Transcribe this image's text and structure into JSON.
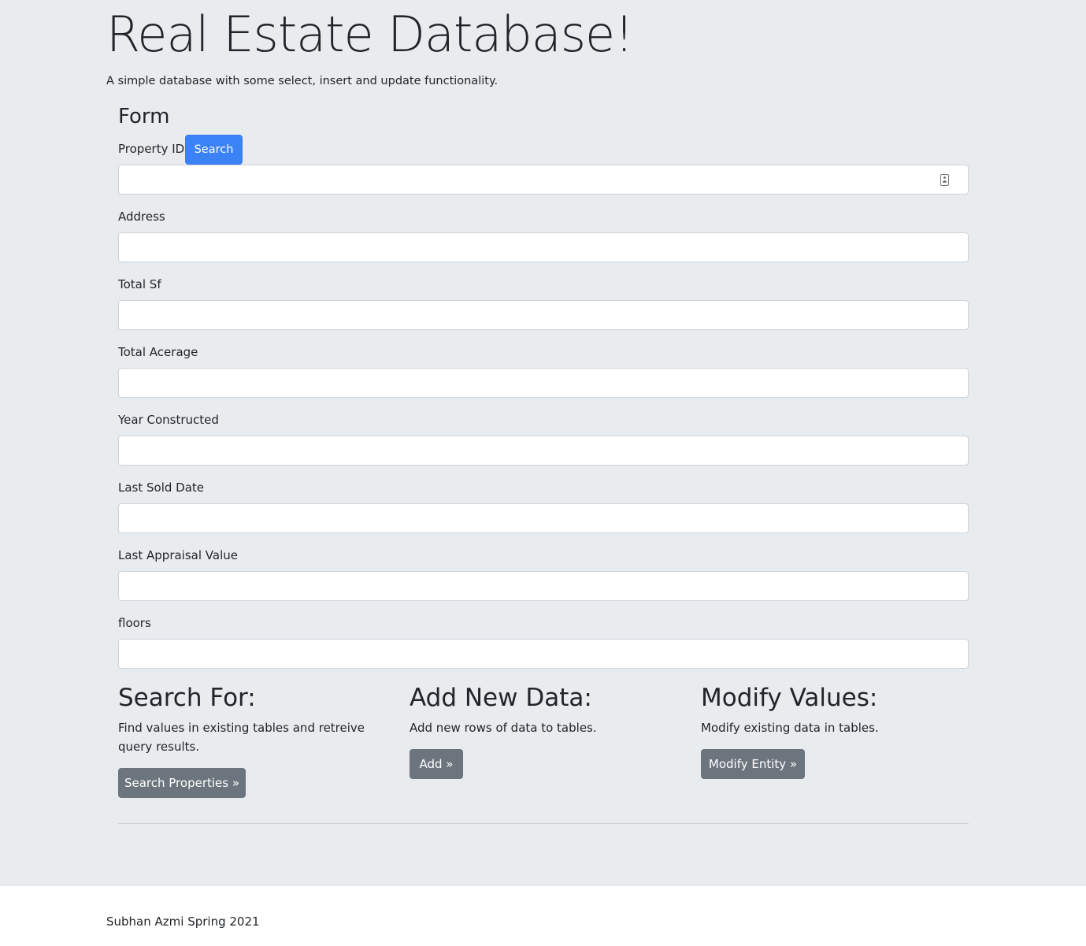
{
  "header": {
    "title": "Real Estate Database!",
    "lead": "A simple database with some select, insert and update functionality."
  },
  "form": {
    "heading": "Form",
    "search_button": "Search",
    "fields": [
      {
        "label": "Property ID",
        "value": ""
      },
      {
        "label": "Address",
        "value": ""
      },
      {
        "label": "Total Sf",
        "value": ""
      },
      {
        "label": "Total Acerage",
        "value": ""
      },
      {
        "label": "Year Constructed",
        "value": ""
      },
      {
        "label": "Last Sold Date",
        "value": ""
      },
      {
        "label": "Last Appraisal Value",
        "value": ""
      },
      {
        "label": "floors",
        "value": ""
      }
    ]
  },
  "sections": [
    {
      "heading": "Search For:",
      "text": "Find values in existing tables and retreive query results.",
      "button": "Search Properties »"
    },
    {
      "heading": "Add New Data:",
      "text": "Add new rows of data to tables.",
      "button": "Add »"
    },
    {
      "heading": "Modify Values:",
      "text": "Modify existing data in tables.",
      "button": "Modify Entity »"
    }
  ],
  "footer": {
    "text": "Subhan Azmi Spring 2021"
  },
  "colors": {
    "jumbotron_bg": "#e9ecef",
    "primary": "#3b82f6",
    "secondary": "#6c757d"
  }
}
